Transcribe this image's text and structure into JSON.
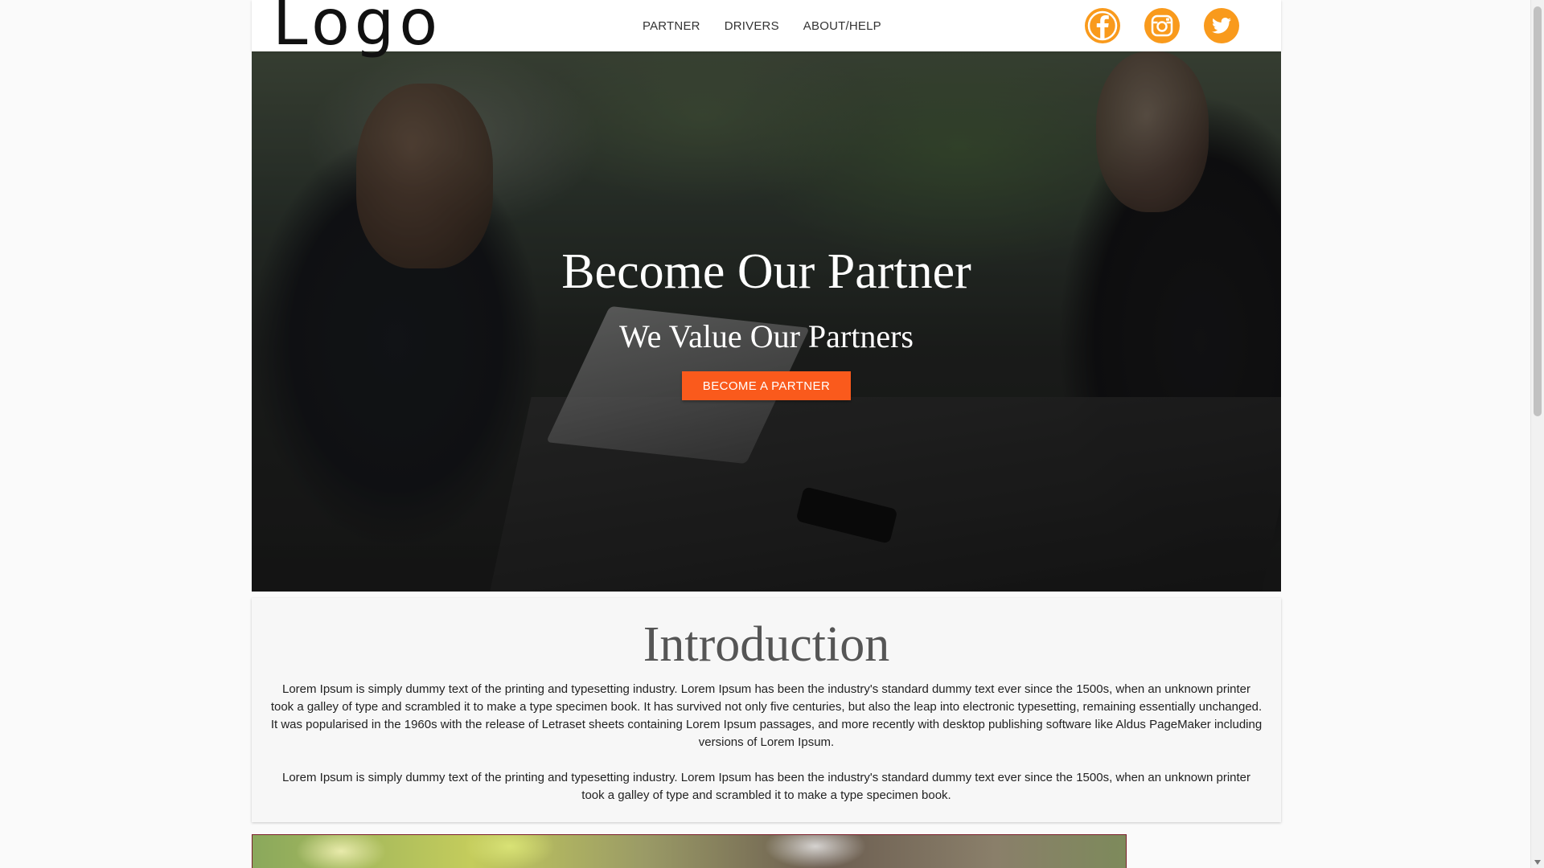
{
  "header": {
    "logo_text": "Logo",
    "nav": [
      "PARTNER",
      "DRIVERS",
      "ABOUT/HELP"
    ],
    "social": [
      {
        "name": "facebook-icon"
      },
      {
        "name": "instagram-icon"
      },
      {
        "name": "twitter-icon"
      }
    ]
  },
  "hero": {
    "title": "Become Our Partner",
    "subtitle": "We Value Our Partners",
    "cta_label": "BECOME A PARTNER"
  },
  "intro": {
    "title": "Introduction",
    "paragraphs": [
      "Lorem Ipsum is simply dummy text of the printing and typesetting industry. Lorem Ipsum has been the industry's standard dummy text ever since the 1500s, when an unknown printer took a galley of type and scrambled it to make a type specimen book. It has survived not only five centuries, but also the leap into electronic typesetting, remaining essentially unchanged. It was popularised in the 1960s with the release of Letraset sheets containing Lorem Ipsum passages, and more recently with desktop publishing software like Aldus PageMaker including versions of Lorem Ipsum.",
      "Lorem Ipsum is simply dummy text of the printing and typesetting industry. Lorem Ipsum has been the industry's standard dummy text ever since the 1500s, when an unknown printer took a galley of type and scrambled it to make a type specimen book."
    ]
  },
  "colors": {
    "social_bg": "#f99a1c",
    "cta_bg": "#fa5a1c",
    "header_bg": "#ffffff",
    "intro_bg": "#f7f7f7"
  }
}
